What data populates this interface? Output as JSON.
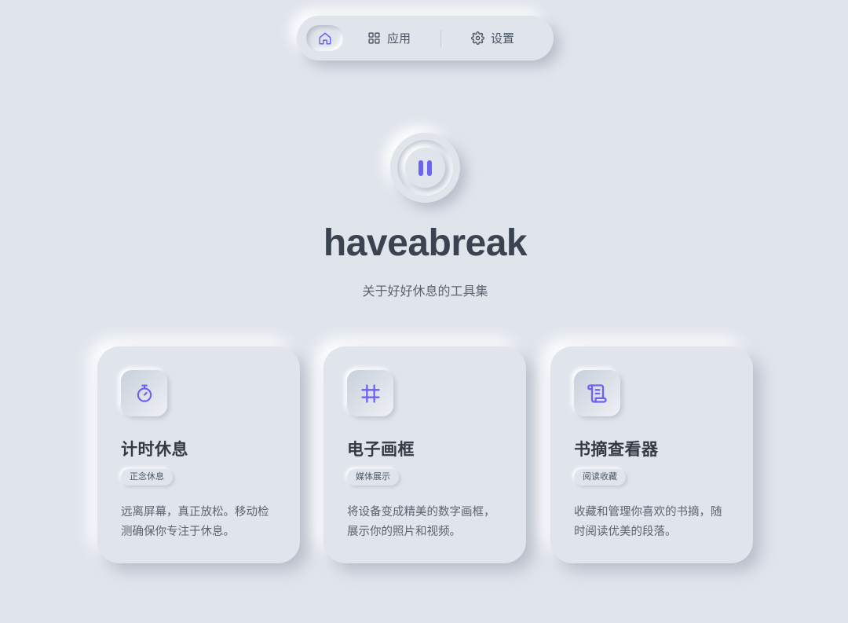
{
  "colors": {
    "background": "#e0e5ec",
    "accent": "#6c63f2",
    "text": "#3b4350",
    "muted": "#5c6470"
  },
  "nav": {
    "home_icon": "home-icon",
    "apps": {
      "icon": "grid-icon",
      "label": "应用"
    },
    "settings": {
      "icon": "gear-icon",
      "label": "设置"
    }
  },
  "hero": {
    "icon": "pause-icon",
    "title": "haveabreak",
    "subtitle": "关于好好休息的工具集"
  },
  "cards": [
    {
      "icon": "stopwatch-icon",
      "title": "计时休息",
      "tag": "正念休息",
      "desc": "远离屏幕，真正放松。移动检测确保你专注于休息。"
    },
    {
      "icon": "frame-icon",
      "title": "电子画框",
      "tag": "媒体展示",
      "desc": "将设备变成精美的数字画框，展示你的照片和视频。"
    },
    {
      "icon": "scroll-icon",
      "title": "书摘查看器",
      "tag": "阅读收藏",
      "desc": "收藏和管理你喜欢的书摘，随时阅读优美的段落。"
    }
  ]
}
